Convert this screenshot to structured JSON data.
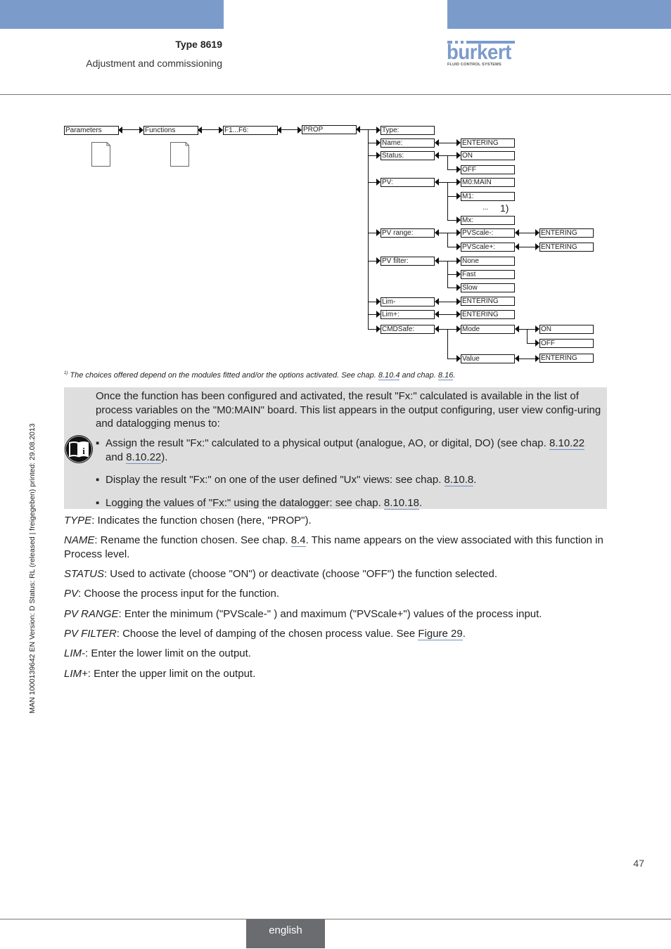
{
  "header": {
    "doc_type": "Type 8619",
    "section": "Adjustment and commissioning",
    "logo": {
      "word": "bürkert",
      "word_display": "burkert",
      "tagline": "FLUID CONTROL SYSTEMS",
      "color": "#7b9bcb"
    },
    "band_color": "#7b9bcb"
  },
  "side_margin_text": "MAN  1000139642  EN  Version: D  Status: RL (released | freigegeben)  printed: 29.08.2013",
  "diagram": {
    "path": [
      "Parameters",
      "Functions",
      "F1...F6:",
      "PROP"
    ],
    "menu": {
      "type": "Type:",
      "name": "Name:",
      "name_value": "ENTERING",
      "status": "Status:",
      "status_options": [
        "ON",
        "OFF"
      ],
      "pv": "PV:",
      "pv_options": [
        "M0:MAIN",
        "M1:",
        "Mx:"
      ],
      "pv_ellipsis": "...",
      "pv_footnote_mark": "1)",
      "pv_range": "PV range:",
      "pv_scale_minus": "PVScale-:",
      "pv_scale_plus": "PVScale+:",
      "pv_scale_value": "ENTERING",
      "pv_filter": "PV filter:",
      "pv_filter_options": [
        "None",
        "Fast",
        "Slow"
      ],
      "lim_minus": "Lim-",
      "lim_plus": "Lim+:",
      "lim_value": "ENTERING",
      "cmdsafe": "CMDSafe:",
      "mode": "Mode",
      "mode_options": [
        "ON",
        "OFF"
      ],
      "value": "Value",
      "value_entry": "ENTERING"
    }
  },
  "footnote": {
    "mark": "1)",
    "text": "The choices offered depend on the modules fitted and/or the options activated. See chap. ",
    "link1": "8.10.4",
    "mid": " and chap. ",
    "link2": "8.16",
    "end": "."
  },
  "note": {
    "icon": "info-book-icon",
    "intro": "Once the function has been configured and activated, the result \"Fx:\" calculated is available in the list of process variables on the \"M0:MAIN\" board. This list appears in the output configuring, user view config-uring and datalogging menus to:",
    "bullets": [
      {
        "pre": "Assign the result \"Fx:\" calculated to a physical output (analogue, AO, or digital, DO) (see chap. ",
        "link1": "8.10.22",
        "mid": " and ",
        "link2": "8.10.22",
        "post": ")."
      },
      {
        "pre": "Display the result \"Fx:\" on one of the user defined \"Ux\" views: see chap. ",
        "link1": "8.10.8",
        "post": "."
      },
      {
        "pre": "Logging the values of \"Fx:\" using the datalogger: see chap. ",
        "link1": "8.10.18",
        "post": "."
      }
    ],
    "bullet_char": "▪"
  },
  "definitions": [
    {
      "term": "TYPE",
      "text": ": Indicates the function chosen (here, \"PROP\")."
    },
    {
      "term": "NAME",
      "text": ": Rename the function chosen. See chap. ",
      "link": "8.4",
      "post": ". This name appears on the view associated with this function in Process level."
    },
    {
      "term": "STATUS",
      "text": ": Used to activate (choose \"ON\") or deactivate (choose \"OFF\") the function selected."
    },
    {
      "term": "PV",
      "text": ": Choose the process input for the function."
    },
    {
      "term": "PV RANGE",
      "text": ": Enter the minimum (\"PVScale-\" ) and maximum (\"PVScale+\") values of the process input."
    },
    {
      "term": "PV FILTER",
      "text": ": Choose the level of damping of the chosen process value. See ",
      "link": "Figure 29",
      "post": "."
    },
    {
      "term": "LIM-",
      "text": ": Enter the lower limit on the output."
    },
    {
      "term": "LIM+",
      "text": ": Enter the upper limit on the output."
    }
  ],
  "footer": {
    "page_number": "47",
    "language": "english"
  }
}
